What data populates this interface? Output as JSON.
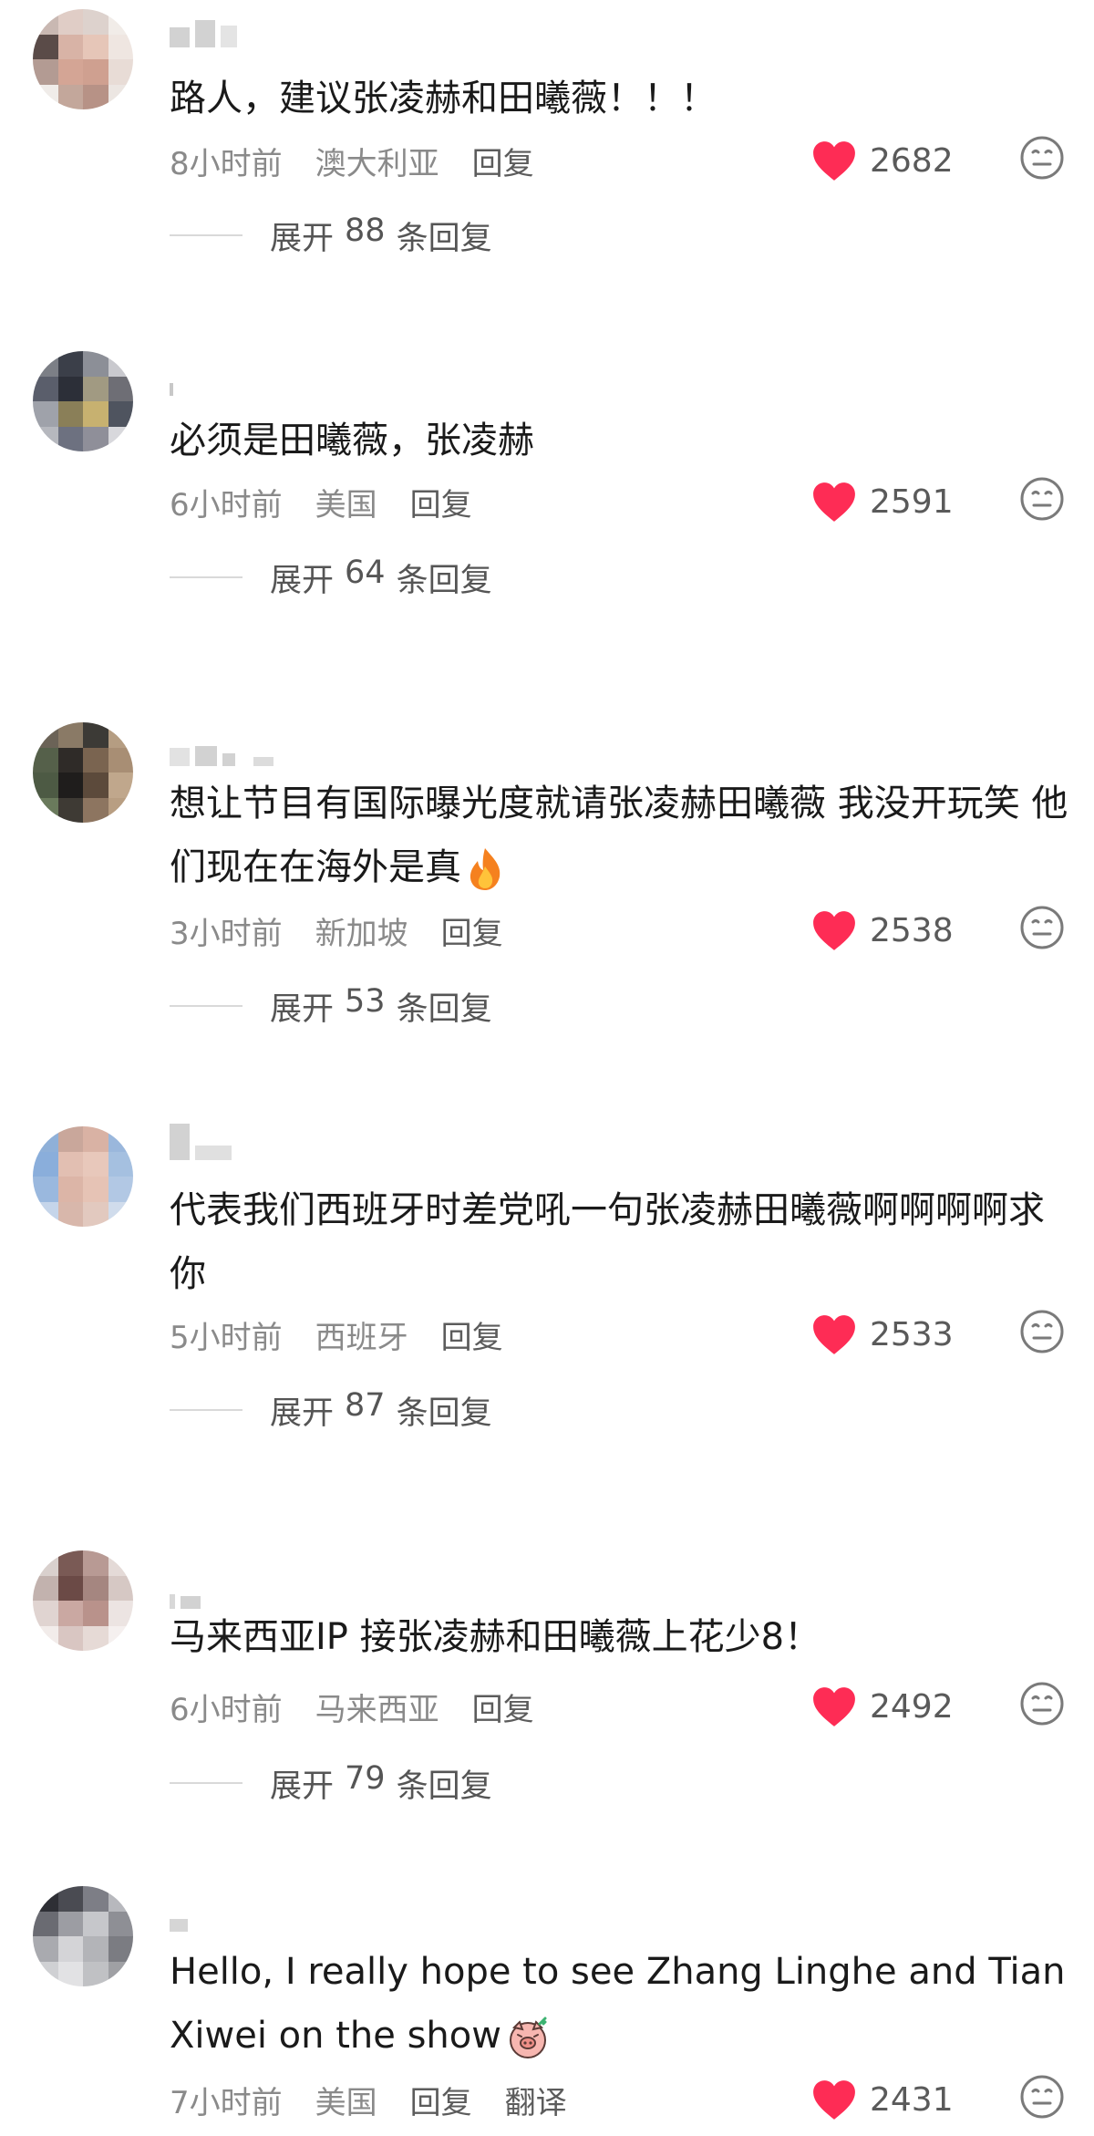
{
  "comments": [
    {
      "text": "路人，建议张凌赫和田曦薇！！！",
      "time": "8小时前",
      "location": "澳大利亚",
      "reply_label": "回复",
      "likes": "2682",
      "expand": {
        "prefix": "展开",
        "count": "88",
        "suffix": "条回复"
      },
      "avatar_colors": [
        "#c9b8b2",
        "#e0cdc6",
        "#ddd2cd",
        "#f1ece8",
        "#5a4b48",
        "#d8b3a6",
        "#e6c6b8",
        "#efe6e1",
        "#b39b93",
        "#d4a595",
        "#cfa090",
        "#e8dcd6",
        "#f0ece9",
        "#c3a79b",
        "#b79286",
        "#ece6e2"
      ]
    },
    {
      "text": "必须是田曦薇，张凌赫",
      "time": "6小时前",
      "location": "美国",
      "reply_label": "回复",
      "likes": "2591",
      "expand": {
        "prefix": "展开",
        "count": "64",
        "suffix": "条回复"
      },
      "avatar_colors": [
        "#7c7f86",
        "#3b3f49",
        "#8c8f97",
        "#c9c9ce",
        "#5a5e6b",
        "#2c2f38",
        "#a19a82",
        "#6e6e75",
        "#9fa2aa",
        "#8a7f58",
        "#c7b170",
        "#4f545f",
        "#b6b8be",
        "#6d7180",
        "#8f8f99",
        "#d8d8dc"
      ]
    },
    {
      "text": "想让节目有国际曝光度就请张凌赫田曦薇 我没开玩笑 他们现在在海外是真",
      "text_emoji": "fire",
      "time": "3小时前",
      "location": "新加坡",
      "reply_label": "回复",
      "likes": "2538",
      "expand": {
        "prefix": "展开",
        "count": "53",
        "suffix": "条回复"
      },
      "avatar_colors": [
        "#6b6357",
        "#8a7a66",
        "#3c3a36",
        "#b59d82",
        "#55604a",
        "#2f2b28",
        "#7a6450",
        "#a88e74",
        "#4d5a44",
        "#1f1d1c",
        "#5c4a3b",
        "#c0a78c",
        "#6a7a5c",
        "#3e3a34",
        "#8d7560",
        "#b89e82"
      ]
    },
    {
      "text": "代表我们西班牙时差党吼一句张凌赫田曦薇啊啊啊啊求你",
      "time": "5小时前",
      "location": "西班牙",
      "reply_label": "回复",
      "likes": "2533",
      "expand": {
        "prefix": "展开",
        "count": "87",
        "suffix": "条回复"
      },
      "avatar_colors": [
        "#8fb0d8",
        "#c9a79b",
        "#d9b2a4",
        "#9ab7dc",
        "#8aaedb",
        "#e2bfb2",
        "#e8c8bb",
        "#a5c0e0",
        "#9ab8de",
        "#dcb5a7",
        "#e6c3b5",
        "#b2c8e4",
        "#c5d5ea",
        "#d8b7ab",
        "#e2c9bf",
        "#d0dcec"
      ]
    },
    {
      "text": "马来西亚IP 接张凌赫和田曦薇上花少8！",
      "time": "6小时前",
      "location": "马来西亚",
      "reply_label": "回复",
      "likes": "2492",
      "expand": {
        "prefix": "展开",
        "count": "79",
        "suffix": "条回复"
      },
      "avatar_colors": [
        "#d9d0cd",
        "#7a5a55",
        "#b89a94",
        "#e4dad7",
        "#c2b2ae",
        "#6b4a46",
        "#a58680",
        "#d6c8c4",
        "#e0d4d1",
        "#caa8a2",
        "#b9928b",
        "#ece4e2",
        "#f2ecea",
        "#d9c6c2",
        "#e6dad6",
        "#f5f0ef"
      ]
    },
    {
      "text": "Hello, I really hope to see Zhang Linghe and Tian Xiwei on the show",
      "text_emoji": "pig-face",
      "time": "7小时前",
      "location": "美国",
      "reply_label": "回复",
      "translate_label": "翻译",
      "likes": "2431",
      "avatar_colors": [
        "#2e2f35",
        "#4a4b52",
        "#7d7e86",
        "#b7b8bd",
        "#6a6b72",
        "#9c9da3",
        "#c6c7cb",
        "#8e8f95",
        "#a9aaaf",
        "#d4d4d7",
        "#b3b4b8",
        "#7b7c82",
        "#cfd0d3",
        "#e2e2e4",
        "#c0c1c4",
        "#9fa0a4"
      ]
    }
  ],
  "colors": {
    "like_heart": "#fe2c55",
    "meta_text": "#8a8a8a",
    "body_text": "#1a1a1a"
  }
}
